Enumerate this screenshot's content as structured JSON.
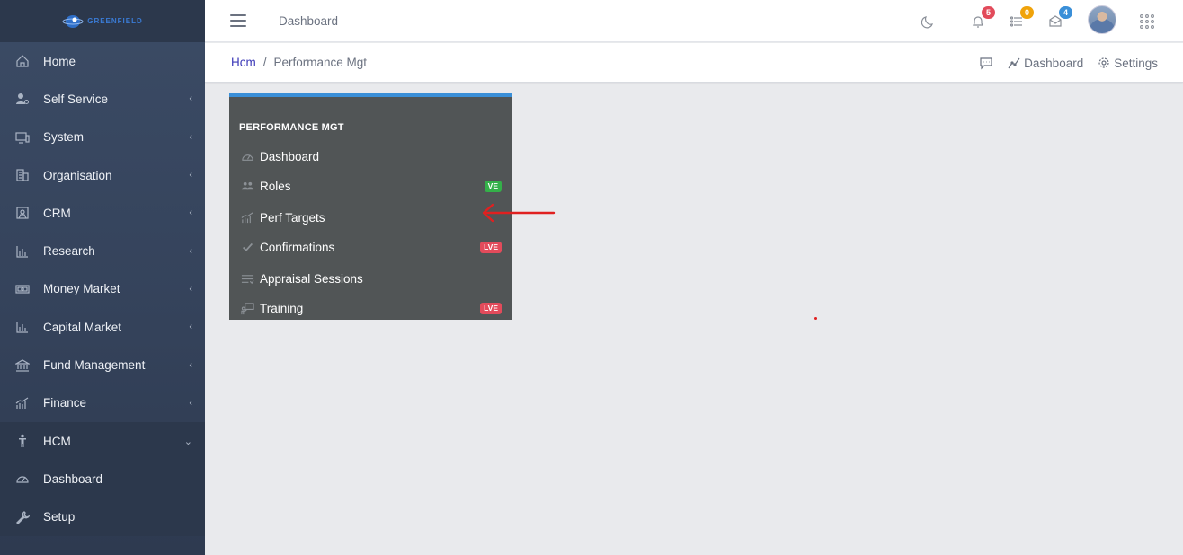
{
  "app": {
    "logo_text": "GREENFIELD",
    "brand_color": "#3a8fd8"
  },
  "sidebar": {
    "items": [
      {
        "label": "Home",
        "icon": "home-icon",
        "chevron": ""
      },
      {
        "label": "Self Service",
        "icon": "user-gear-icon",
        "chevron": "‹"
      },
      {
        "label": "System",
        "icon": "monitor-icon",
        "chevron": "‹"
      },
      {
        "label": "Organisation",
        "icon": "building-icon",
        "chevron": "‹"
      },
      {
        "label": "CRM",
        "icon": "contact-book-icon",
        "chevron": "‹"
      },
      {
        "label": "Research",
        "icon": "bar-chart-icon",
        "chevron": "‹"
      },
      {
        "label": "Money Market",
        "icon": "banknote-icon",
        "chevron": "‹"
      },
      {
        "label": "Capital Market",
        "icon": "bar-chart-icon",
        "chevron": "‹"
      },
      {
        "label": "Fund Management",
        "icon": "bank-icon",
        "chevron": "‹"
      },
      {
        "label": "Finance",
        "icon": "growth-chart-icon",
        "chevron": "‹"
      },
      {
        "label": "HCM",
        "icon": "person-icon",
        "chevron": "⌄"
      },
      {
        "label": "Dashboard",
        "icon": "speedometer-icon",
        "chevron": ""
      },
      {
        "label": "Setup",
        "icon": "wrench-icon",
        "chevron": ""
      }
    ]
  },
  "topbar": {
    "title": "Dashboard",
    "notifications": {
      "bell": "5",
      "tasks": "0",
      "messages": "4"
    },
    "badge_colors": {
      "bell": "#e24b5b",
      "tasks": "#f0a30a",
      "messages": "#3a8fd8"
    }
  },
  "breadcrumb": {
    "root": "Hcm",
    "separator": "/",
    "current": "Performance Mgt",
    "dashboard_label": "Dashboard",
    "settings_label": "Settings"
  },
  "panel": {
    "title": "PERFORMANCE MGT",
    "items": [
      {
        "label": "Dashboard",
        "icon": "speedometer-icon",
        "badge": ""
      },
      {
        "label": "Roles",
        "icon": "users-icon",
        "badge": "VE",
        "badge_color": "green"
      },
      {
        "label": "Perf Targets",
        "icon": "growth-chart-icon",
        "badge": ""
      },
      {
        "label": "Confirmations",
        "icon": "check-icon",
        "badge": "LVE",
        "badge_color": "red"
      },
      {
        "label": "Appraisal Sessions",
        "icon": "list-icon",
        "badge": ""
      },
      {
        "label": "Training",
        "icon": "presentation-icon",
        "badge": "LVE",
        "badge_color": "red"
      }
    ]
  },
  "annotation": {
    "arrow_color": "#e02020"
  }
}
